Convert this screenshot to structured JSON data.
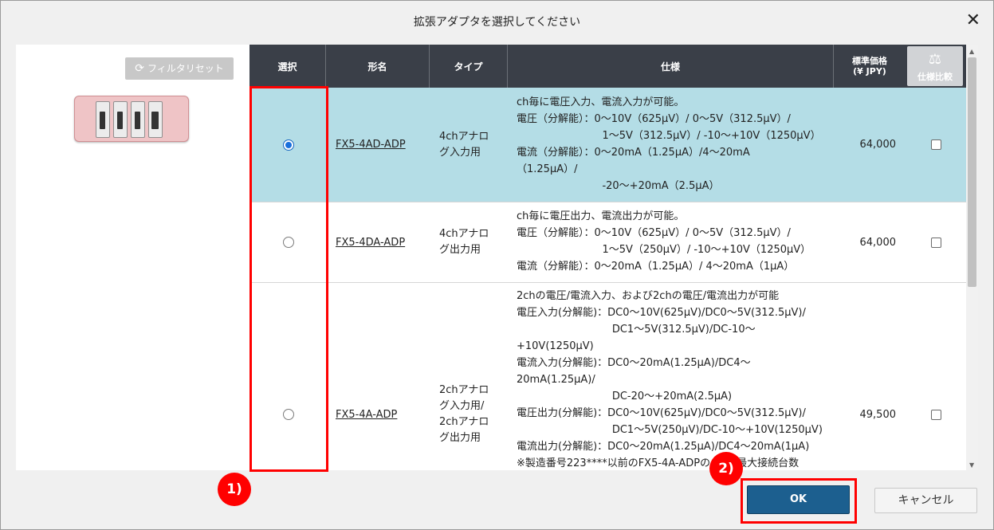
{
  "dialog": {
    "title": "拡張アダプタを選択してください",
    "close_glyph": "✕"
  },
  "left_panel": {
    "filter_reset_label": "フィルタリセット",
    "filter_reset_icon": "refresh-icon",
    "thumbnail_icon": "adapter-modules-image"
  },
  "table": {
    "headers": {
      "select": "選択",
      "model": "形名",
      "type": "タイプ",
      "spec": "仕様",
      "price_line1": "標準価格",
      "price_line2": "(¥ JPY)",
      "compare": "仕様比較",
      "compare_icon": "scale-icon"
    },
    "rows": [
      {
        "selected": true,
        "model": "FX5-4AD-ADP",
        "type": "4chアナロ\nグ入力用",
        "spec": "ch毎に電圧入力、電流入力が可能。\n電圧（分解能）：0～10V（625μV）/ 0～5V（312.5μV）/\n                          1～5V（312.5μV）/ -10～+10V（1250μV）\n電流（分解能）：0～20mA（1.25μA）/4～20mA\n（1.25μA）/\n                          -20～+20mA（2.5μA）",
        "price": "64,000",
        "compare_checked": false
      },
      {
        "selected": false,
        "model": "FX5-4DA-ADP",
        "type": "4chアナロ\nグ出力用",
        "spec": "ch毎に電圧出力、電流出力が可能。\n電圧（分解能）：0～10V（625μV）/ 0～5V（312.5μV）/\n                          1～5V（250μV）/ -10～+10V（1250μV）\n電流（分解能）：0～20mA（1.25μA）/ 4～20mA（1μA）",
        "price": "64,000",
        "compare_checked": false
      },
      {
        "selected": false,
        "model": "FX5-4A-ADP",
        "type": "2chアナロ\nグ入力用/\n2chアナロ\nグ出力用",
        "spec": "2chの電圧/電流入力、および2chの電圧/電流出力が可能\n電圧入力(分解能)：DC0～10V(625μV)/DC0～5V(312.5μV)/\n                             DC1～5V(312.5μV)/DC-10～\n+10V(1250μV)\n電流入力(分解能)：DC0～20mA(1.25μA)/DC4～\n20mA(1.25μA)/\n                             DC-20～+20mA(2.5μA)\n電圧出力(分解能)：DC0～10V(625μV)/DC0～5V(312.5μV)/\n                             DC1～5V(250μV)/DC-10～+10V(1250μV)\n電流出力(分解能)：DC0～20mA(1.25μA)/DC4～20mA(1μA)\n※製造番号223****以前のFX5-4A-ADPの        最大接続台数",
        "price": "49,500",
        "compare_checked": false
      }
    ]
  },
  "annotations": {
    "badge1": "1)",
    "badge2": "2)"
  },
  "footer": {
    "ok_label": "OK",
    "cancel_label": "キャンセル"
  }
}
